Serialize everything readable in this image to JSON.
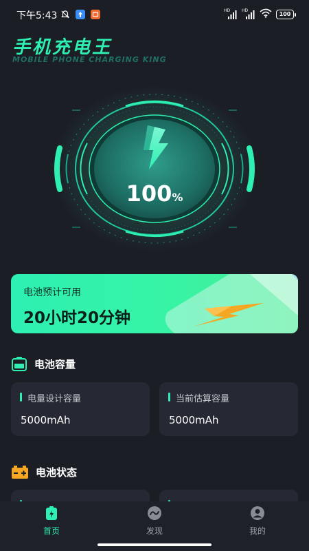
{
  "status_bar": {
    "time": "下午5:43",
    "battery_level": "100",
    "icons": [
      "mute-bell-icon",
      "upload-icon",
      "app-notify-icon",
      "hd-signal-icon",
      "hd-signal-icon",
      "wifi-icon",
      "battery-icon"
    ]
  },
  "header": {
    "title": "手机充电王",
    "subtitle": "MOBILE PHONE CHARGING KING"
  },
  "gauge": {
    "percent": "100",
    "unit": "%",
    "level": 1.0,
    "icon": "lightning-bolt-icon"
  },
  "estimate": {
    "label": "电池预计可用",
    "value": "20小时20分钟"
  },
  "capacity_section": {
    "title": "电池容量",
    "icon": "battery-outline-icon",
    "cards": [
      {
        "label": "电量设计容量",
        "value": "5000mAh"
      },
      {
        "label": "当前估算容量",
        "value": "5000mAh"
      }
    ]
  },
  "status_section": {
    "title": "电池状态",
    "icon": "battery-plus-minus-icon"
  },
  "bottom_nav": {
    "items": [
      {
        "label": "首页",
        "icon": "home-battery-icon",
        "active": true
      },
      {
        "label": "发现",
        "icon": "discover-icon",
        "active": false
      },
      {
        "label": "我的",
        "icon": "profile-icon",
        "active": false
      }
    ]
  },
  "colors": {
    "accent": "#2ef0b2",
    "background": "#1c1e26",
    "card": "#262833",
    "nav_bg": "#1f212a",
    "bolt_orange": "#f5a623"
  }
}
